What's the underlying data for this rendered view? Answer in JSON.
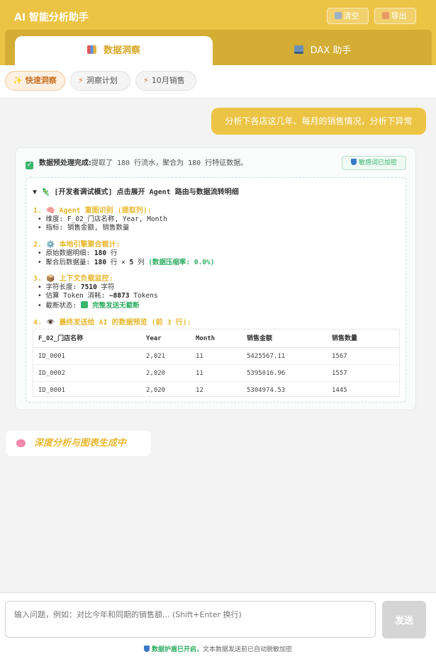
{
  "app": {
    "title": "AI 智能分析助手"
  },
  "header": {
    "clear_label": "清空",
    "export_label": "导出"
  },
  "tabs": [
    {
      "label": "数据洞察",
      "active": true,
      "icon": "bar-chart-icon"
    },
    {
      "label": "DAX 助手",
      "active": false,
      "icon": "laptop-icon"
    }
  ],
  "chips": [
    {
      "label": "快速洞察",
      "active": true,
      "icon": "sparkle-icon"
    },
    {
      "label": "洞察计划",
      "active": false,
      "icon": "bolt-icon"
    },
    {
      "label": "10月销售",
      "active": false,
      "icon": "bolt-icon"
    }
  ],
  "user_message": "分析下各店这几年、每月的销售情况，分析下异常",
  "assistant": {
    "preprocess_label": "数据预处理完成:",
    "preprocess_text": "提取了 180 行流水，聚合为 180 行特征数据。",
    "sensitive_badge": "敏感词已加密",
    "debug_title": "▼ 🦎 [开发者调试模式] 点击展开 Agent 路由与数据流转明细",
    "sections": [
      {
        "title": "1. 🧠 Agent 意图识别 (提取列):",
        "lines": [
          "• 维度: F_02_门店名称, Year, Month",
          "• 指标: 销售金额, 销售数量"
        ]
      },
      {
        "title": "2. ⚙️ 本地引擎聚合裁计:",
        "line1_prefix": "• 原始数据明细:",
        "line1_value": "180",
        "line1_suffix": "行",
        "line2_prefix": "• 聚合后数据量:",
        "line2_rows": "180",
        "line2_mid": "行 × ",
        "line2_cols": "5",
        "line2_suffix": "列",
        "line2_ratio": "(数据压缩率: 0.0%)"
      },
      {
        "title": "3. 📦 上下文负载监控:",
        "line1_prefix": "• 字符长度:",
        "line1_value": "7510",
        "line1_suffix": "字符",
        "line2_prefix": "• 估算 Token 消耗:",
        "line2_value": "~8873",
        "line2_suffix": "Tokens",
        "line3_prefix": "• 截断状态:",
        "line3_status": "完整发送无截断"
      },
      {
        "title": "4. 👁️ 最终发送给 AI 的数据预览 (前 3 行):"
      }
    ],
    "preview": {
      "headers": [
        "F_02_门店名称",
        "Year",
        "Month",
        "销售金额",
        "销售数量"
      ],
      "rows": [
        [
          "ID_0001",
          "2,021",
          "11",
          "5425567.11",
          "1567"
        ],
        [
          "ID_0002",
          "2,020",
          "11",
          "5395016.96",
          "1557"
        ],
        [
          "ID_0001",
          "2,020",
          "12",
          "5304974.53",
          "1445"
        ]
      ]
    }
  },
  "generating": "深度分析与图表生成中",
  "input": {
    "placeholder": "输入问题，例如：对比今年和同期的销售额... (Shift+Enter 换行)",
    "send_label": "发送"
  },
  "guard": {
    "bold": "数据护盾已开启，",
    "text": "文本数据发送前已自动脱敏加密"
  }
}
